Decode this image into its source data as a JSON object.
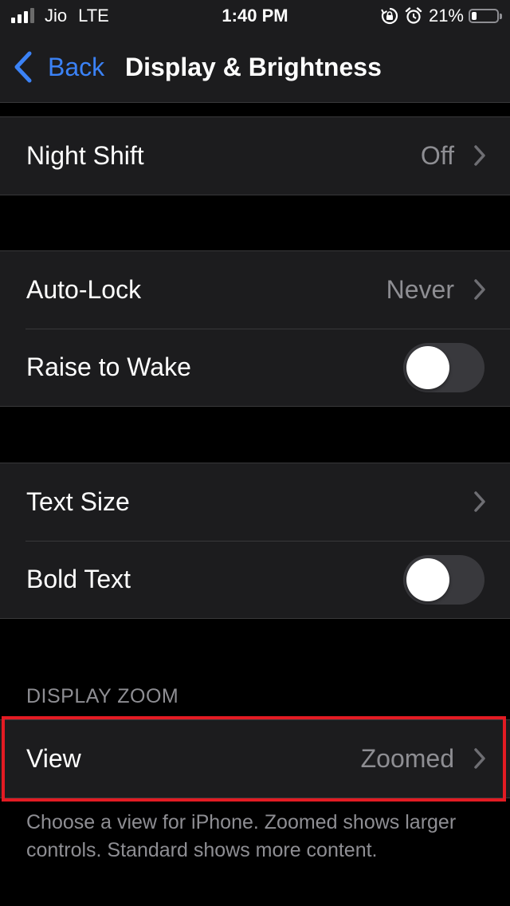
{
  "status_bar": {
    "carrier": "Jio",
    "network": "LTE",
    "time": "1:40 PM",
    "battery_percent": "21%",
    "battery_level": 0.21,
    "signal_bars_active": 3,
    "icons": [
      "rotation-lock-icon",
      "alarm-icon"
    ]
  },
  "nav": {
    "back_label": "Back",
    "title": "Display & Brightness"
  },
  "groups": {
    "night_shift": {
      "label": "Night Shift",
      "value": "Off"
    },
    "auto_lock": {
      "label": "Auto-Lock",
      "value": "Never"
    },
    "raise_to_wake": {
      "label": "Raise to Wake",
      "on": false
    },
    "text_size": {
      "label": "Text Size"
    },
    "bold_text": {
      "label": "Bold Text",
      "on": false
    }
  },
  "display_zoom": {
    "header": "DISPLAY ZOOM",
    "view_label": "View",
    "view_value": "Zoomed",
    "footer": "Choose a view for iPhone. Zoomed shows larger controls. Standard shows more content."
  },
  "colors": {
    "background": "#000000",
    "cell": "#1c1c1e",
    "separator": "#38383a",
    "accent": "#3b82f6",
    "secondary_text": "#8e8e93",
    "highlight": "#e31b23"
  }
}
